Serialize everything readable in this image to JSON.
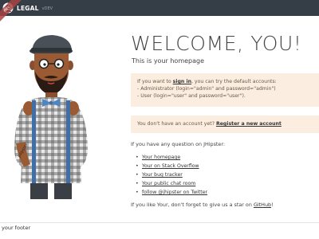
{
  "navbar": {
    "ribbon_text": "dev",
    "brand_name": "LEGAL",
    "brand_version": "vDEV",
    "bg_color": "#353d47"
  },
  "main": {
    "title": "WELCOME, YOU!",
    "subtitle": "This is your homepage",
    "signin_alert": {
      "prefix": "If you want to ",
      "signin_link": "sign in",
      "suffix": ", you can try the default accounts:",
      "admin_line": "- Administrator (login=\"admin\" and password=\"admin\")",
      "user_line": "- User (login=\"user\" and password=\"user\")."
    },
    "register_alert": {
      "text": "You don't have an account yet? ",
      "register_link": "Register a new account"
    },
    "question": "If you have any question on JHipster:",
    "links": [
      "Your homepage",
      "Your on Stack Overflow",
      "Your bug tracker",
      "Your public chat room",
      "follow @jhipster on Twitter"
    ],
    "star": {
      "prefix": "If you like Your, don't forget to give us a star on ",
      "github_link": "GitHub",
      "suffix": "!"
    },
    "alert_bg_color": "#fbeee0"
  },
  "footer": {
    "text": "your footer"
  },
  "illustration": {
    "name": "jhipster-mascot"
  }
}
